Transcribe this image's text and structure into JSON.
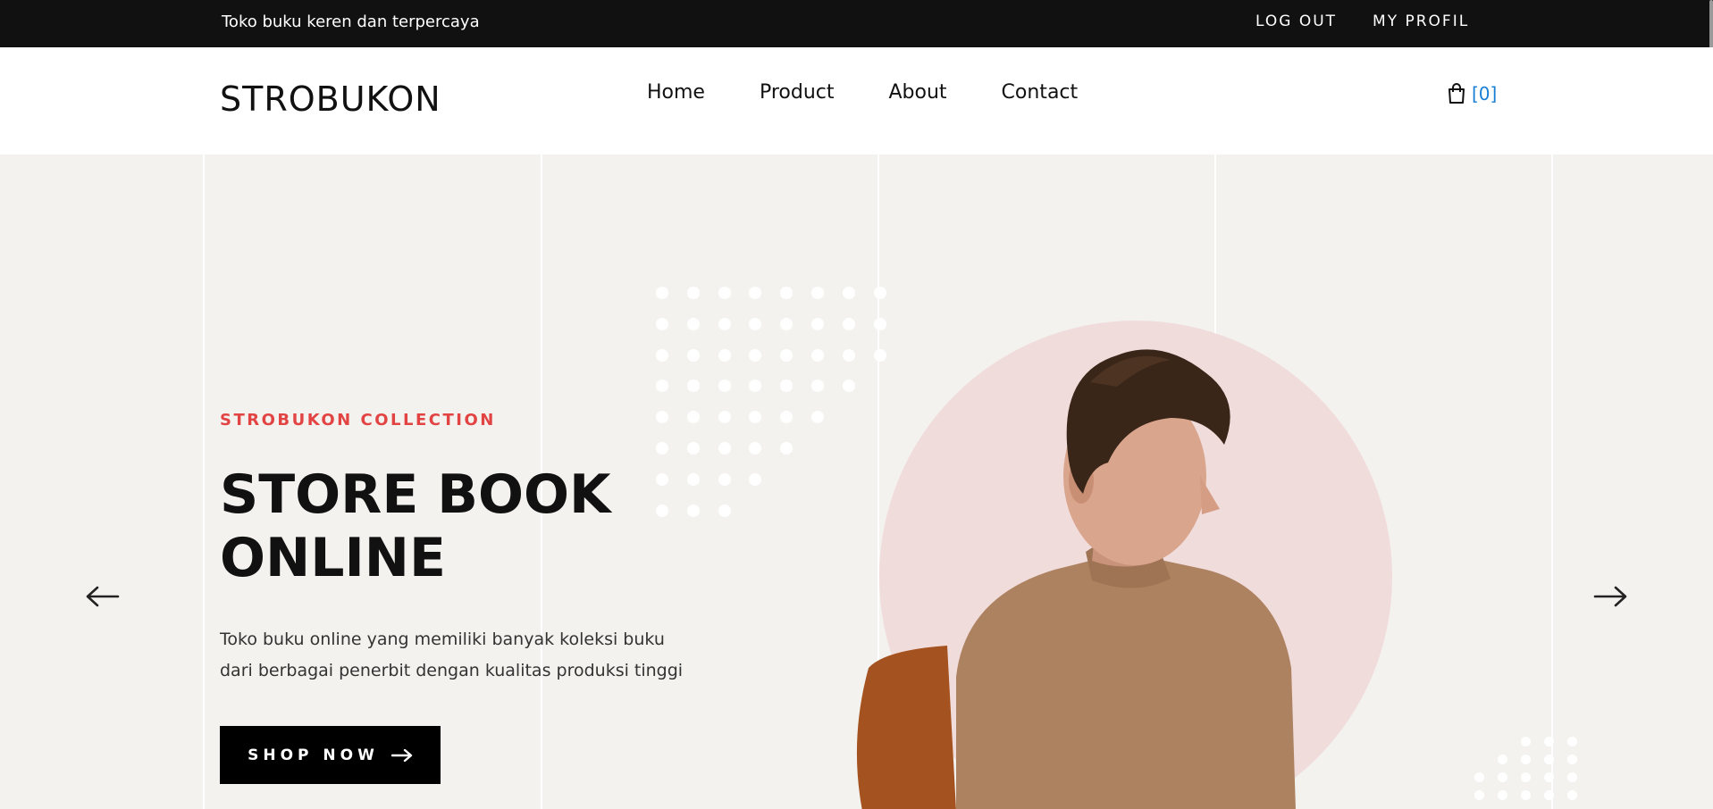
{
  "topbar": {
    "tagline": "Toko buku keren dan terpercaya",
    "logout": "LOG OUT",
    "profile": "MY PROFIL"
  },
  "header": {
    "logo": "STROBUKON",
    "nav": [
      "Home",
      "Product",
      "About",
      "Contact"
    ],
    "cart_count": "[0]"
  },
  "hero": {
    "collection": "STROBUKON COLLECTION",
    "title_line1": "STORE BOOK",
    "title_line2": "ONLINE",
    "description": "Toko buku online yang memiliki banyak koleksi buku dari berbagai penerbit dengan kualitas produksi tinggi",
    "button": "SHOP NOW"
  },
  "icons": {
    "cart": "shopping-bag-icon",
    "prev": "arrow-left-icon",
    "next": "arrow-right-icon",
    "button": "arrow-right-icon"
  },
  "colors": {
    "topbar": "#111111",
    "accent": "#e24444",
    "cart_count": "#1a7fd4",
    "hero_bg": "#f3f2ee",
    "circle": "#f1dcdc"
  }
}
